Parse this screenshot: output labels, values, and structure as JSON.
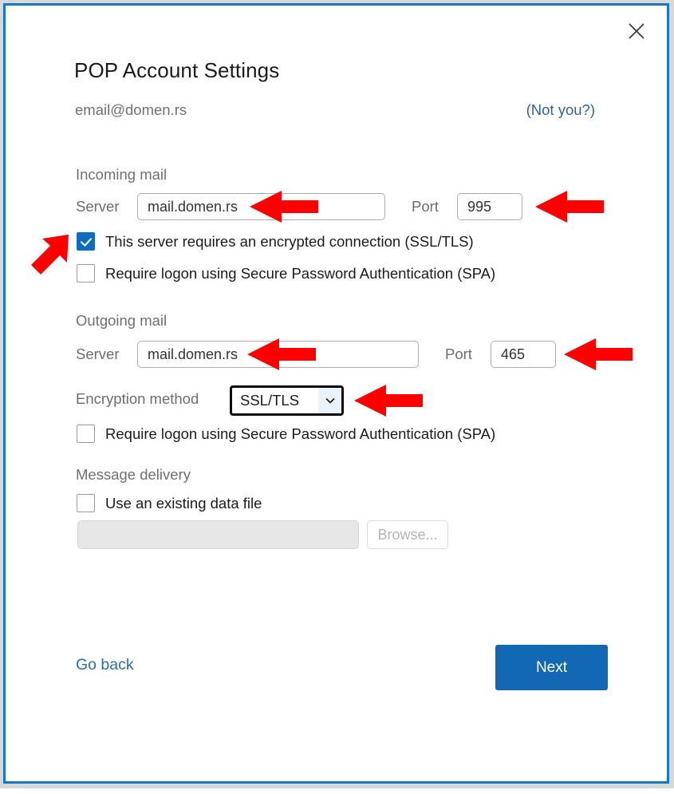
{
  "window": {
    "close_icon": "close-icon",
    "border_color": "#1678c8"
  },
  "header": {
    "title": "POP Account Settings",
    "email": "email@domen.rs",
    "not_you_link": "(Not you?)"
  },
  "incoming": {
    "heading": "Incoming mail",
    "server_label": "Server",
    "server_value": "mail.domen.rs",
    "port_label": "Port",
    "port_value": "995",
    "ssl_checkbox_label": "This server requires an encrypted connection (SSL/TLS)",
    "ssl_checkbox_checked": true,
    "spa_checkbox_label": "Require logon using Secure Password Authentication (SPA)",
    "spa_checkbox_checked": false
  },
  "outgoing": {
    "heading": "Outgoing mail",
    "server_label": "Server",
    "server_value": "mail.domen.rs",
    "port_label": "Port",
    "port_value": "465",
    "encryption_label": "Encryption method",
    "encryption_value": "SSL/TLS",
    "encryption_chevron_icon": "chevron-down-icon",
    "spa_checkbox_label": "Require logon using Secure Password Authentication (SPA)",
    "spa_checkbox_checked": false
  },
  "delivery": {
    "heading": "Message delivery",
    "use_data_file_label": "Use an existing data file",
    "use_data_file_checked": false,
    "data_file_value": "",
    "data_file_placeholder": "",
    "browse_label": "Browse..."
  },
  "footer": {
    "go_back_label": "Go back",
    "next_label": "Next",
    "next_color": "#1268b3"
  },
  "annotations": {
    "color": "#ff0000",
    "arrows": [
      {
        "name": "arrow-incoming-server",
        "target": "incoming server field"
      },
      {
        "name": "arrow-incoming-port",
        "target": "incoming port field"
      },
      {
        "name": "arrow-ssl-checkbox",
        "target": "SSL/TLS checkbox"
      },
      {
        "name": "arrow-outgoing-server",
        "target": "outgoing server field"
      },
      {
        "name": "arrow-outgoing-port",
        "target": "outgoing port field"
      },
      {
        "name": "arrow-encryption-method",
        "target": "encryption method dropdown"
      }
    ]
  }
}
